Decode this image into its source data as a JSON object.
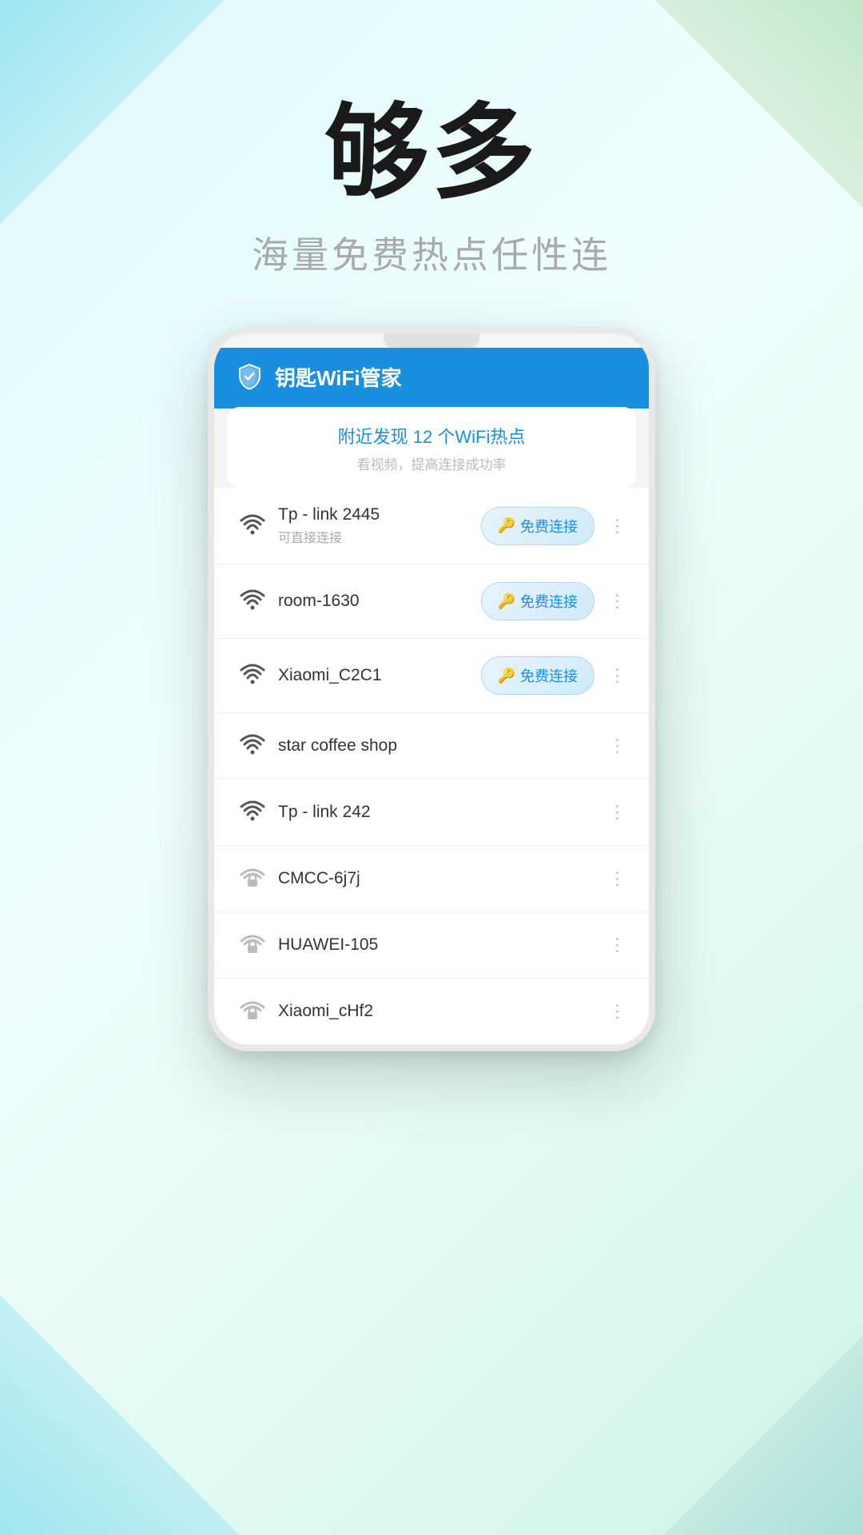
{
  "hero": {
    "title": "够多",
    "subtitle": "海量免费热点任性连"
  },
  "app": {
    "title": "钥匙WiFi管家",
    "discovery_title": "附近发现 12 个WiFi热点",
    "discovery_sub": "看视频，提高连接成功率"
  },
  "wifi_list": [
    {
      "name": "Tp - link 2445",
      "sub": "可直接连接",
      "has_button": true,
      "button_label": "免费连接",
      "locked": false,
      "signal": 4
    },
    {
      "name": "room-1630",
      "sub": "",
      "has_button": true,
      "button_label": "免费连接",
      "locked": false,
      "signal": 3
    },
    {
      "name": "Xiaomi_C2C1",
      "sub": "",
      "has_button": true,
      "button_label": "免费连接",
      "locked": false,
      "signal": 3
    },
    {
      "name": "star coffee shop",
      "sub": "",
      "has_button": false,
      "button_label": "",
      "locked": false,
      "signal": 3
    },
    {
      "name": "Tp - link 242",
      "sub": "",
      "has_button": false,
      "button_label": "",
      "locked": false,
      "signal": 3
    },
    {
      "name": "CMCC-6j7j",
      "sub": "",
      "has_button": false,
      "button_label": "",
      "locked": true,
      "signal": 3
    },
    {
      "name": "HUAWEI-105",
      "sub": "",
      "has_button": false,
      "button_label": "",
      "locked": true,
      "signal": 2
    },
    {
      "name": "Xiaomi_cHf2",
      "sub": "",
      "has_button": false,
      "button_label": "",
      "locked": true,
      "signal": 2
    }
  ]
}
